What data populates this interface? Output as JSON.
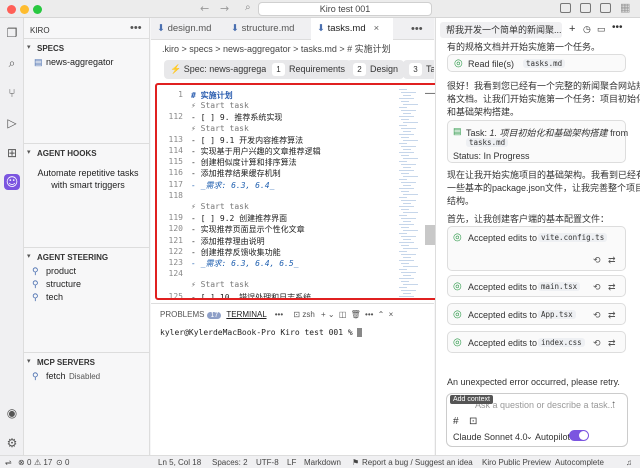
{
  "window": {
    "title": "Kiro test 001"
  },
  "sidebar": {
    "title": "KIRO",
    "specs_header": "SPECS",
    "specs": [
      "news-aggregator"
    ],
    "hooks_header": "AGENT HOOKS",
    "hooks_desc": "Automate repetitive tasks with smart triggers",
    "steering_header": "AGENT STEERING",
    "steering": [
      "product",
      "structure",
      "tech"
    ],
    "mcp_header": "MCP SERVERS",
    "mcp_name": "fetch",
    "mcp_status": "Disabled"
  },
  "editor": {
    "tabs": [
      {
        "label": "design.md",
        "active": false
      },
      {
        "label": "structure.md",
        "active": false
      },
      {
        "label": "tasks.md",
        "active": true
      }
    ],
    "breadcrumb": ".kiro > specs > news-aggregator > tasks.md > # 实施计划",
    "spec_label": "Spec: news-aggregator",
    "spec_steps": [
      {
        "num": "1",
        "label": "Requirements"
      },
      {
        "num": "2",
        "label": "Design"
      },
      {
        "num": "3",
        "label": "Ta"
      }
    ],
    "lines": [
      {
        "num": "1",
        "text": "# 实施计划",
        "kind": "h"
      },
      {
        "num": "",
        "text": "⚡ Start task",
        "kind": "task"
      },
      {
        "num": "112",
        "text": "- [ ] 9. 推荐系统实现",
        "kind": "n"
      },
      {
        "num": "",
        "text": "⚡ Start task",
        "kind": "task"
      },
      {
        "num": "113",
        "text": "  - [ ] 9.1 开发内容推荐算法",
        "kind": "n"
      },
      {
        "num": "114",
        "text": "    - 实现基于用户兴趣的文章推荐逻辑",
        "kind": "n"
      },
      {
        "num": "115",
        "text": "    - 创建相似度计算和排序算法",
        "kind": "n"
      },
      {
        "num": "116",
        "text": "    - 添加推荐结果缓存机制",
        "kind": "n"
      },
      {
        "num": "117",
        "text": "    - _需求: 6.3, 6.4_",
        "kind": "it"
      },
      {
        "num": "118",
        "text": "",
        "kind": "n"
      },
      {
        "num": "",
        "text": "⚡ Start task",
        "kind": "task"
      },
      {
        "num": "119",
        "text": "  - [ ] 9.2 创建推荐界面",
        "kind": "n"
      },
      {
        "num": "120",
        "text": "    - 实现推荐页面显示个性化文章",
        "kind": "n"
      },
      {
        "num": "121",
        "text": "    - 添加推荐理由说明",
        "kind": "n"
      },
      {
        "num": "122",
        "text": "    - 创建推荐反馈收集功能",
        "kind": "n"
      },
      {
        "num": "123",
        "text": "    - _需求: 6.3, 6.4, 6.5_",
        "kind": "it"
      },
      {
        "num": "124",
        "text": "",
        "kind": "n"
      },
      {
        "num": "",
        "text": "⚡ Start task",
        "kind": "task"
      },
      {
        "num": "125",
        "text": "- [ ] 10. 错误处理和日志系统",
        "kind": "n"
      }
    ]
  },
  "panel": {
    "problems_label": "PROBLEMS",
    "problems_count": "17",
    "terminal_label": "TERMINAL",
    "shell": "zsh",
    "prompt": "kyler@KylerdeMacBook-Pro Kiro test 001 %"
  },
  "chat": {
    "tab_title": "帮我开发一个简单的新闻聚...",
    "top_line": "有的规格文档并开始实施第一个任务。",
    "readfile_label": "Read file(s)",
    "readfile_name": "tasks.md",
    "p1": [
      "很好！我看到您已经有一个完整的新闻聚合网站规",
      "格文档。让我们开始实施第一个任务：项目初始化",
      "和基础架构搭建。"
    ],
    "task_prefix": "Task:",
    "task_text": "1. 项目初始化和基础架构搭建",
    "task_from": "from",
    "task_file": "tasks.md",
    "task_status": "Status: In Progress",
    "p2": [
      "现在让我开始实施项目的基础架构。我看到已经有",
      "一些基本的package.json文件，让我完善整个项目",
      "结构。"
    ],
    "p3": "首先，让我创建客户端的基本配置文件：",
    "edits_label": "Accepted edits to",
    "edits": [
      "vite.config.ts",
      "main.tsx",
      "App.tsx",
      "index.css"
    ],
    "error": "An unexpected error occurred, please retry.",
    "tooltip": "Add context",
    "input_placeholder": "Ask a question or describe a task...",
    "model": "Claude Sonnet 4.0",
    "autopilot": "Autopilot"
  },
  "status": {
    "errors": "0",
    "warnings": "17",
    "ports": "0",
    "position": "Ln 5, Col 18",
    "spaces": "Spaces: 2",
    "encoding": "UTF-8",
    "eol": "LF",
    "language": "Markdown",
    "report": "Report a bug / Suggest an idea",
    "preview": "Kiro Public Preview",
    "autocomplete": "Autocomplete"
  }
}
